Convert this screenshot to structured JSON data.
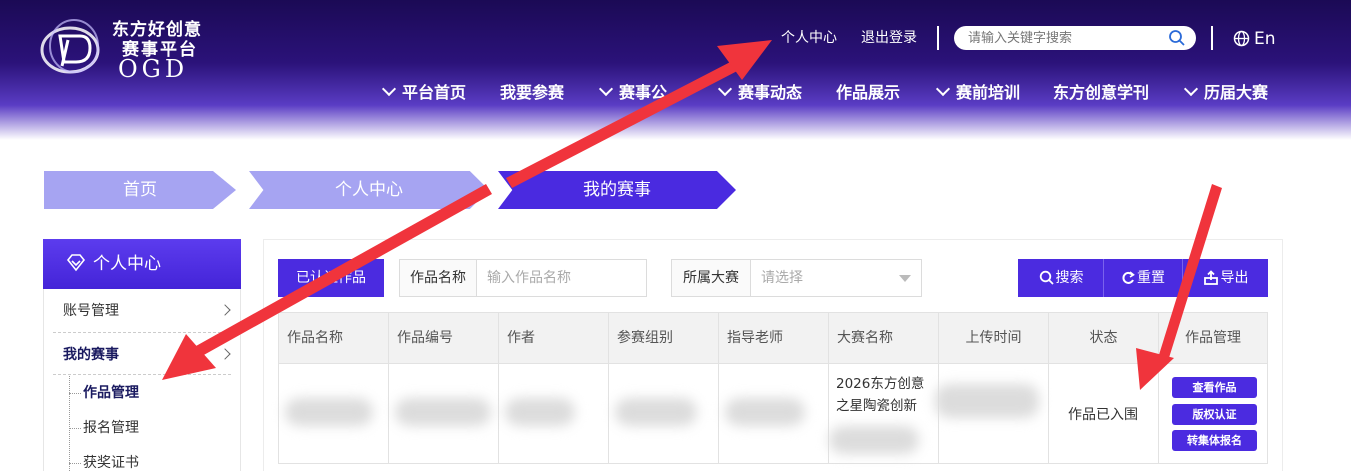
{
  "brand": {
    "name_line1": "东方好创意",
    "name_line2": "赛事平台",
    "name_en": "OGD"
  },
  "toplinks": {
    "personal_center": "个人中心",
    "logout": "退出登录",
    "search_placeholder": "请输入关键字搜索",
    "language": "En"
  },
  "nav": {
    "items": [
      {
        "label": "平台首页",
        "dropdown": true
      },
      {
        "label": "我要参赛",
        "dropdown": false
      },
      {
        "label": "赛事公",
        "dropdown": true
      },
      {
        "label": "赛事动态",
        "dropdown": true
      },
      {
        "label": "作品展示",
        "dropdown": false
      },
      {
        "label": "赛前培训",
        "dropdown": true
      },
      {
        "label": "东方创意学刊",
        "dropdown": false
      },
      {
        "label": "历届大赛",
        "dropdown": true
      }
    ]
  },
  "breadcrumb": [
    "首页",
    "个人中心",
    "我的赛事"
  ],
  "sidebar": {
    "title": "个人中心",
    "items": [
      {
        "label": "账号管理"
      },
      {
        "label": "我的赛事"
      }
    ],
    "sub_items": [
      {
        "label": "作品管理",
        "active": true
      },
      {
        "label": "报名管理",
        "active": false
      },
      {
        "label": "获奖证书",
        "active": false
      }
    ]
  },
  "toolbar": {
    "tab_label": "已认证作品",
    "work_name_label": "作品名称",
    "work_name_placeholder": "输入作品名称",
    "contest_label": "所属大赛",
    "contest_placeholder": "请选择",
    "search_btn": "搜索",
    "reset_btn": "重置",
    "export_btn": "导出"
  },
  "table": {
    "columns": [
      "作品名称",
      "作品编号",
      "作者",
      "参赛组别",
      "指导老师",
      "大赛名称",
      "上传时间",
      "状态",
      "作品管理"
    ],
    "rows": [
      {
        "contest_name": "2026东方创意之星陶瓷创新",
        "status": "作品已入围",
        "actions": [
          "查看作品",
          "版权认证",
          "转集体报名"
        ]
      }
    ]
  },
  "colors": {
    "accent": "#4b2be0",
    "breadcrumb_inactive": "#a6a4f2",
    "annotation_arrow": "#f0343c"
  }
}
